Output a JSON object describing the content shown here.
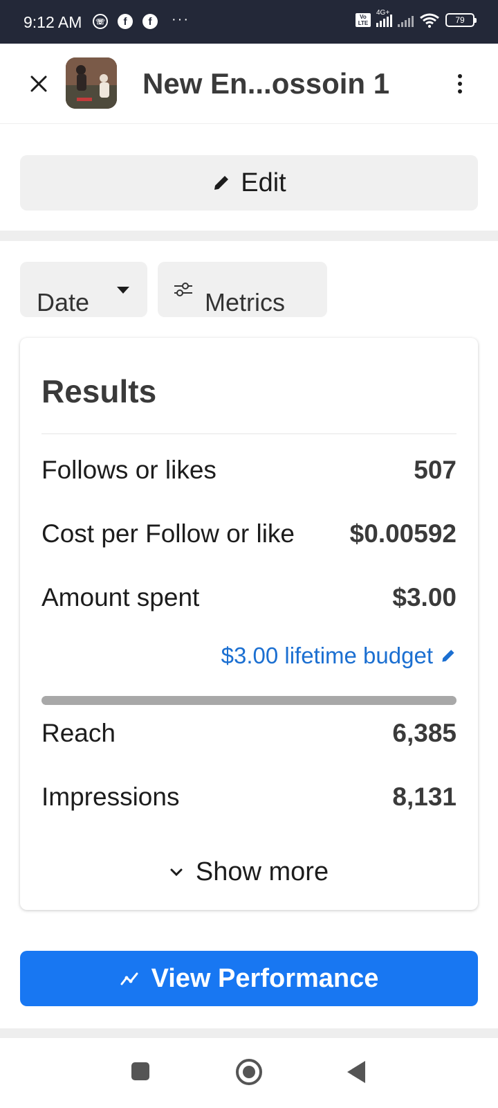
{
  "status_bar": {
    "time": "9:12 AM",
    "network": "4G+",
    "volte": "Vo LTE",
    "battery": "79"
  },
  "header": {
    "title": "New En...ossoin 1",
    "thumbnail_icon": "ad-thumbnail-image"
  },
  "edit": {
    "label": "Edit",
    "icon": "pencil-icon"
  },
  "filters": {
    "date_label": "Date",
    "metrics_label": "Metrics"
  },
  "results": {
    "title": "Results",
    "rows_top": [
      {
        "label": "Follows or likes",
        "value": "507"
      },
      {
        "label": "Cost per Follow or like",
        "value": "$0.00592"
      },
      {
        "label": "Amount spent",
        "value": "$3.00"
      }
    ],
    "budget_label": "$3.00 lifetime budget",
    "budget_spent_fraction": 1.0,
    "rows_bottom": [
      {
        "label": "Reach",
        "value": "6,385"
      },
      {
        "label": "Impressions",
        "value": "8,131"
      }
    ],
    "show_more_label": "Show more"
  },
  "view_performance": {
    "label": "View Performance",
    "icon": "trend-line-icon"
  },
  "colors": {
    "primary_blue": "#1877f2",
    "link_blue": "#1b6fd1",
    "status_bar": "#232838",
    "chip_bg": "#f0f0f0"
  }
}
